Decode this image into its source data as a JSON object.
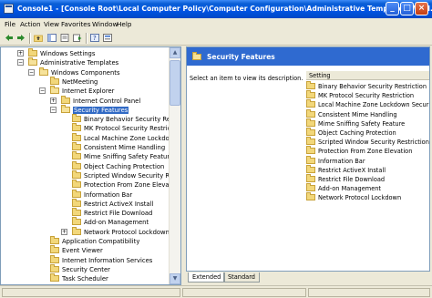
{
  "window": {
    "title": "Console1 - [Console Root\\Local Computer Policy\\Computer Configuration\\Administrative Templates\\Wind...",
    "minimize_label": "_",
    "maximize_label": "□",
    "close_label": "×"
  },
  "menu": {
    "file": "File",
    "action": "Action",
    "view": "View",
    "favorites": "Favorites",
    "window": "Window",
    "help": "Help"
  },
  "tree": {
    "items": [
      {
        "label": "Windows Settings",
        "kind": "folder",
        "expander": "+"
      },
      {
        "label": "Administrative Templates",
        "kind": "folder-open",
        "expander": "−"
      },
      {
        "label": "Windows Components",
        "kind": "folder-open",
        "expander": "−"
      },
      {
        "label": "NetMeeting",
        "kind": "folder",
        "expander": ""
      },
      {
        "label": "Internet Explorer",
        "kind": "folder-open",
        "expander": "−"
      },
      {
        "label": "Internet Control Panel",
        "kind": "folder",
        "expander": "+"
      },
      {
        "label": "Security Features",
        "kind": "folder-open",
        "expander": "−",
        "selected": true
      },
      {
        "label": "Binary Behavior Security Restric",
        "kind": "folder",
        "expander": ""
      },
      {
        "label": "MK Protocol Security Restriction",
        "kind": "folder",
        "expander": ""
      },
      {
        "label": "Local Machine Zone Lockdown",
        "kind": "folder",
        "expander": ""
      },
      {
        "label": "Consistent Mime Handling",
        "kind": "folder",
        "expander": ""
      },
      {
        "label": "Mime Sniffing Safety Feature",
        "kind": "folder",
        "expander": ""
      },
      {
        "label": "Object Caching Protection",
        "kind": "folder",
        "expander": ""
      },
      {
        "label": "Scripted Window Security Restrict",
        "kind": "folder",
        "expander": ""
      },
      {
        "label": "Protection From Zone Elevation",
        "kind": "folder",
        "expander": ""
      },
      {
        "label": "Information Bar",
        "kind": "folder",
        "expander": ""
      },
      {
        "label": "Restrict ActiveX Install",
        "kind": "folder",
        "expander": ""
      },
      {
        "label": "Restrict File Download",
        "kind": "folder",
        "expander": ""
      },
      {
        "label": "Add-on Management",
        "kind": "folder",
        "expander": ""
      },
      {
        "label": "Network Protocol Lockdown",
        "kind": "folder",
        "expander": "+"
      },
      {
        "label": "Application Compatibility",
        "kind": "folder",
        "expander": ""
      },
      {
        "label": "Event Viewer",
        "kind": "folder",
        "expander": ""
      },
      {
        "label": "Internet Information Services",
        "kind": "folder",
        "expander": ""
      },
      {
        "label": "Security Center",
        "kind": "folder",
        "expander": ""
      },
      {
        "label": "Task Scheduler",
        "kind": "folder",
        "expander": ""
      }
    ]
  },
  "details": {
    "header_title": "Security Features",
    "description": "Select an item to view its description.",
    "column_setting": "Setting",
    "settings": [
      "Binary Behavior Security Restriction",
      "MK Protocol Security Restriction",
      "Local Machine Zone Lockdown Security",
      "Consistent Mime Handling",
      "Mime Sniffing Safety Feature",
      "Object Caching Protection",
      "Scripted Window Security Restrictions",
      "Protection From Zone Elevation",
      "Information Bar",
      "Restrict ActiveX Install",
      "Restrict File Download",
      "Add-on Management",
      "Network Protocol Lockdown"
    ]
  },
  "tabs": {
    "extended": "Extended",
    "standard": "Standard"
  },
  "colors": {
    "titlebar": "#0054e3",
    "selection": "#316ac5",
    "header": "#2f6ad0"
  }
}
